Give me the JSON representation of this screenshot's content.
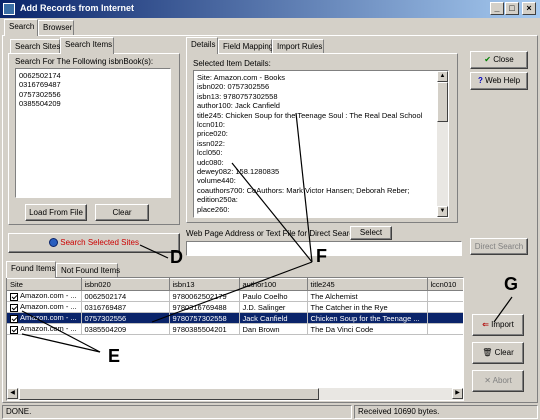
{
  "window": {
    "title": "Add Records from Internet",
    "minimize": "_",
    "maximize": "□",
    "close": "×"
  },
  "top_tabs": [
    "Search",
    "Browser"
  ],
  "left": {
    "tabs": [
      "Search Sites",
      "Search Items"
    ],
    "search_label": "Search For The Following isbnBook(s):",
    "isbns": "0062502174\n0316769487\n0757302556\n0385504209",
    "load_button": "Load From File",
    "clear_button": "Clear"
  },
  "detail": {
    "tabs": [
      "Details",
      "Field Mapping",
      "Import Rules"
    ],
    "label": "Selected Item Details:",
    "text": "Site: Amazon.com - Books\nisbn020: 0757302556\nisbn13: 9780757302558\nauthor100: Jack Canfield\ntitle245: Chicken Soup for the Teenage Soul : The Real Deal School\nlccn010:\nprice020:\nissn022:\nlccl050:\nudc080:\ndewey082: 158.1280835\nvolume440:\ncoauthors700: CoAuthors: Mark Victor Hansen; Deborah Reber;\nedition250a:\nplace260:"
  },
  "right_buttons": {
    "close": "Close",
    "web_help": "Web Help",
    "import": "Import",
    "clear": "Clear",
    "abort": "Abort"
  },
  "search_selected_sites": "Search Selected Sites",
  "web_address": {
    "label": "Web Page Address or Text File for Direct Search:",
    "select": "Select",
    "direct_search": "Direct Search",
    "value": ""
  },
  "results": {
    "tabs": [
      "Found Items",
      "Not Found Items"
    ],
    "columns": [
      "Site",
      "isbn020",
      "isbn13",
      "author100",
      "title245",
      "lccn010"
    ],
    "rows": [
      {
        "site": "Amazon.com - ...",
        "isbn020": "0062502174",
        "isbn13": "9780062502179",
        "author": "Paulo Coelho",
        "title": "The Alchemist",
        "lccn": ""
      },
      {
        "site": "Amazon.com - ...",
        "isbn020": "0316769487",
        "isbn13": "9780316769488",
        "author": "J.D. Salinger",
        "title": "The Catcher in the Rye",
        "lccn": ""
      },
      {
        "site": "Amazon.com - ...",
        "isbn020": "0757302556",
        "isbn13": "9780757302558",
        "author": "Jack Canfield",
        "title": "Chicken Soup for the Teenage ...",
        "lccn": ""
      },
      {
        "site": "Amazon.com - ...",
        "isbn020": "0385504209",
        "isbn13": "9780385504201",
        "author": "Dan Brown",
        "title": "The Da Vinci Code",
        "lccn": ""
      }
    ]
  },
  "status": {
    "left": "DONE.",
    "right": "Received 10690 bytes."
  },
  "annotations": {
    "D": "D",
    "E": "E",
    "F": "F",
    "G": "G"
  },
  "colors": {
    "title_bar": "#0a246a",
    "selection": "#0a246a",
    "search_text": "#cc0000",
    "face": "#d4d0c8"
  }
}
